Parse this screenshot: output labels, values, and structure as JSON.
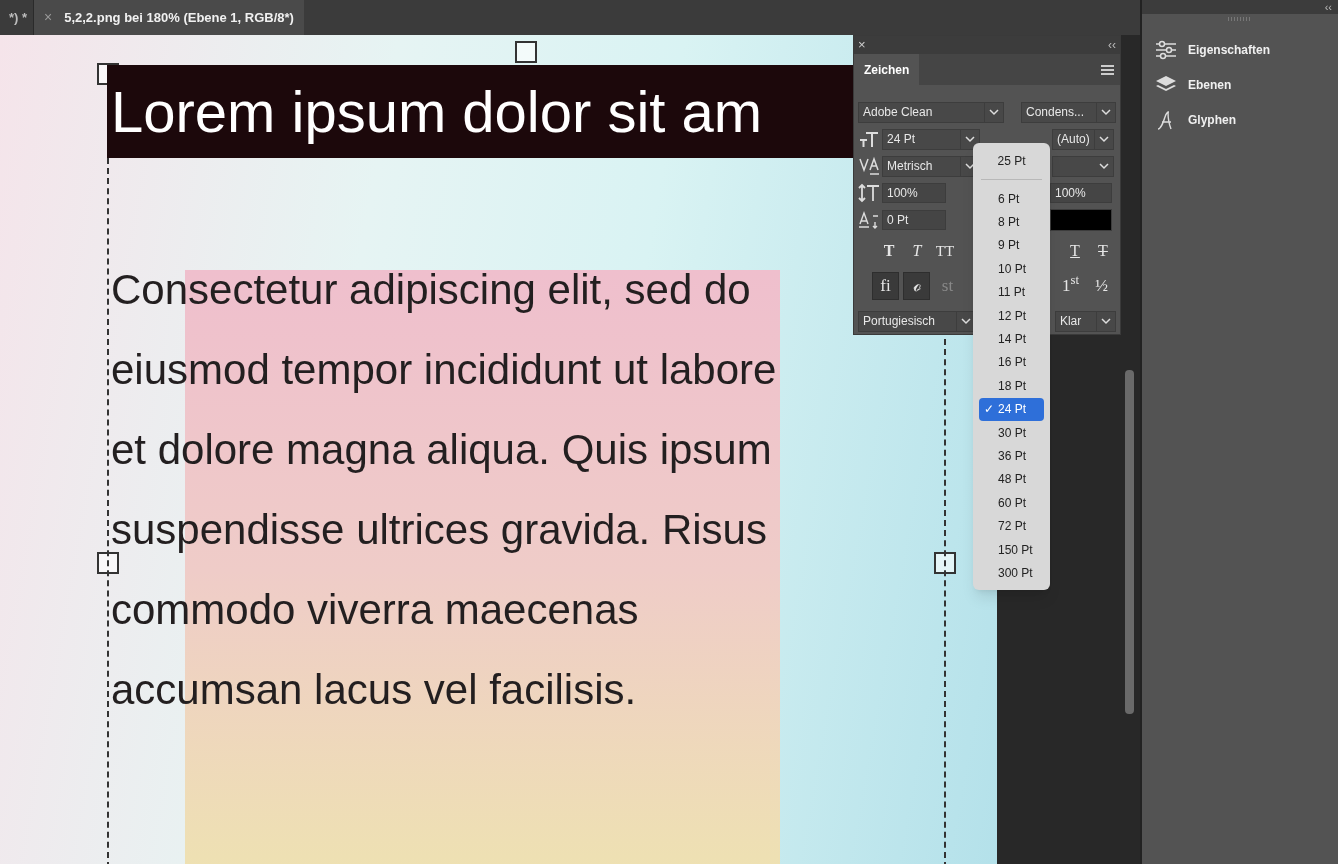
{
  "document_tabs": [
    {
      "label": "*) *",
      "selected": false
    },
    {
      "label": "5,2,2.png bei 180% (Ebene 1, RGB/8*)",
      "selected": true,
      "close": "×"
    }
  ],
  "canvas": {
    "heading": "Lorem ipsum dolor sit am",
    "body_lines": [
      "Consectetur adipiscing elit, sed do",
      "eiusmod tempor incididunt ut labore",
      "et dolore magna aliqua. Quis ipsum",
      "suspendisse ultrices gravida. Risus",
      "commodo viverra maecenas",
      "accumsan lacus vel facilisis."
    ]
  },
  "character_panel": {
    "close": "×",
    "collapse": "‹‹",
    "tab": "Zeichen",
    "font_family": "Adobe Clean",
    "font_style": "Condens...",
    "font_size": "24 Pt",
    "leading": "(Auto)",
    "kerning": "Metrisch",
    "vertical_scale": "100%",
    "horizontal_scale": "100%",
    "baseline_shift": "0 Pt",
    "style_buttons": [
      {
        "glyph": "T",
        "kind": "bold"
      },
      {
        "glyph": "T",
        "kind": "italic"
      },
      {
        "glyph": "TT",
        "kind": "caps"
      },
      {
        "glyph": "T",
        "kind": "underline"
      },
      {
        "glyph": "T",
        "kind": "strike"
      }
    ],
    "opentype_buttons": [
      {
        "glyph": "fi",
        "selected": true,
        "disabled": false
      },
      {
        "glyph": "ℴ",
        "selected": true,
        "disabled": false
      },
      {
        "glyph": "st",
        "selected": false,
        "disabled": true
      },
      {
        "glyph": "1$^{st}$",
        "selected": false,
        "disabled": false
      },
      {
        "glyph": "½",
        "selected": false,
        "disabled": false
      }
    ],
    "language": "Portugiesisch",
    "anti_aliasing": "Klar"
  },
  "size_menu": {
    "current": "25 Pt",
    "check_mark": "✓",
    "options": [
      {
        "label": "6 Pt",
        "selected": false
      },
      {
        "label": "8 Pt",
        "selected": false
      },
      {
        "label": "9 Pt",
        "selected": false
      },
      {
        "label": "10 Pt",
        "selected": false
      },
      {
        "label": "11 Pt",
        "selected": false
      },
      {
        "label": "12 Pt",
        "selected": false
      },
      {
        "label": "14 Pt",
        "selected": false
      },
      {
        "label": "16 Pt",
        "selected": false
      },
      {
        "label": "18 Pt",
        "selected": false
      },
      {
        "label": "24 Pt",
        "selected": true
      },
      {
        "label": "30 Pt",
        "selected": false
      },
      {
        "label": "36 Pt",
        "selected": false
      },
      {
        "label": "48 Pt",
        "selected": false
      },
      {
        "label": "60 Pt",
        "selected": false
      },
      {
        "label": "72 Pt",
        "selected": false
      },
      {
        "label": "150 Pt",
        "selected": false
      },
      {
        "label": "300 Pt",
        "selected": false
      }
    ]
  },
  "right_panel": {
    "collapse": "‹‹",
    "items": [
      {
        "label": "Eigenschaften",
        "kind": "properties"
      },
      {
        "label": "Ebenen",
        "kind": "layers"
      },
      {
        "label": "Glyphen",
        "kind": "glyphs"
      }
    ]
  }
}
